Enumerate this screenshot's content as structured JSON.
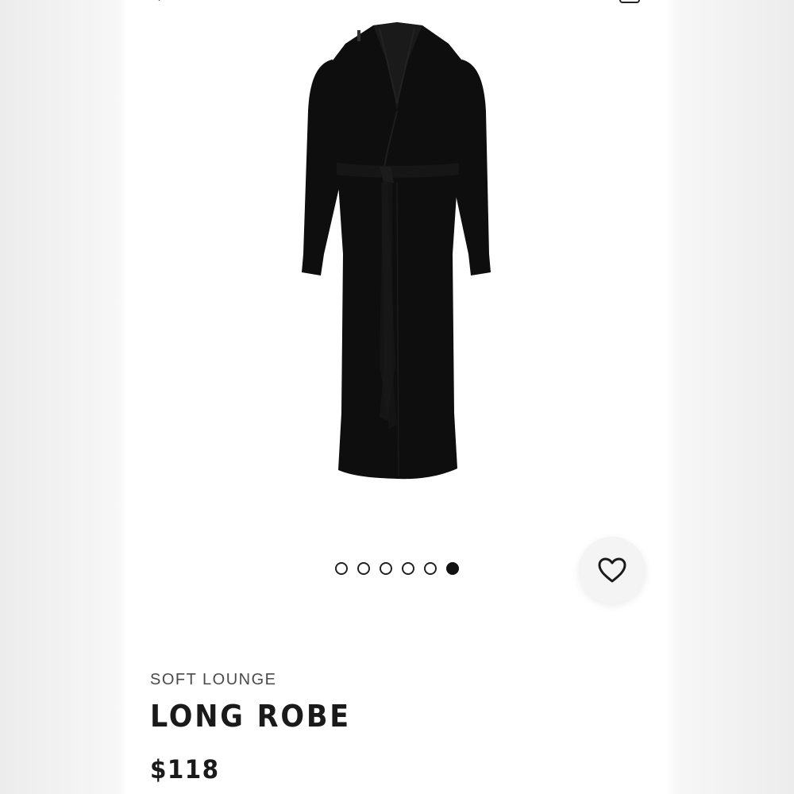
{
  "product": {
    "collection": "SOFT LOUNGE",
    "name": "LONG ROBE",
    "price": "$118",
    "image_icon": "long-robe-image",
    "color": "#0e0e0e"
  },
  "carousel": {
    "total": 6,
    "active_index": 5
  },
  "actions": {
    "favorite_icon": "heart-icon",
    "top_right_icon": "bag-icon",
    "top_left_icon": "back-arrow-icon"
  }
}
